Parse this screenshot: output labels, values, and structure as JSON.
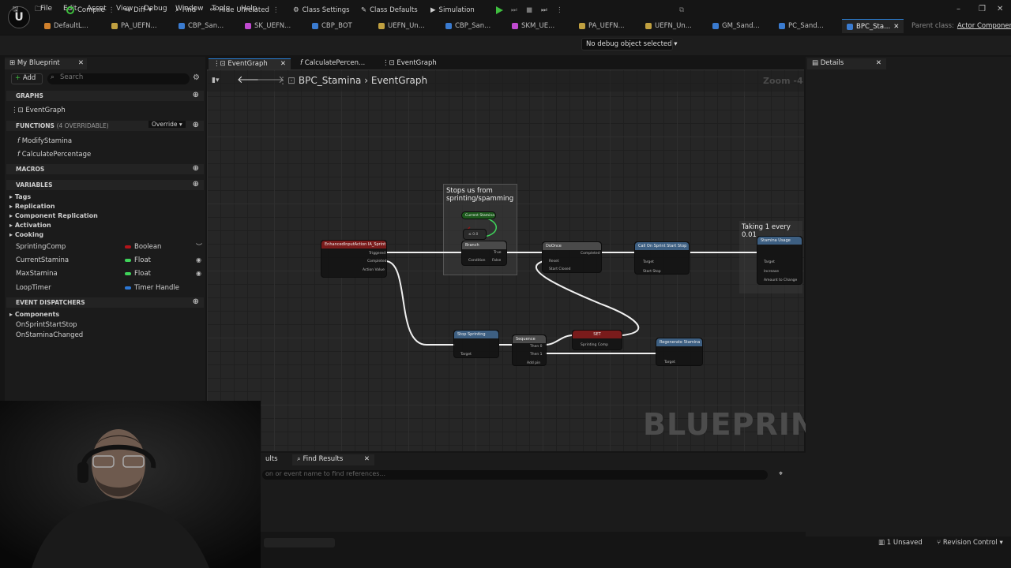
{
  "menu": [
    "File",
    "Edit",
    "Asset",
    "View",
    "Debug",
    "Window",
    "Tools",
    "Help"
  ],
  "tabs": [
    "DefaultL...",
    "PA_UEFN...",
    "CBP_San...",
    "SK_UEFN...",
    "CBP_BOT",
    "UEFN_Un...",
    "CBP_San...",
    "SKM_UE...",
    "PA_UEFN...",
    "UEFN_Un...",
    "GM_Sand...",
    "PC_Sand...",
    "BPC_Sta..."
  ],
  "parent_class": {
    "label": "Parent class:",
    "value": "Actor Component"
  },
  "toolbar": {
    "compile": "Compile",
    "diff": "Diff",
    "find": "Find",
    "hide_unrelated": "Hide Unrelated",
    "class_settings": "Class Settings",
    "class_defaults": "Class Defaults",
    "simulation": "Simulation",
    "debug_object": "No debug object selected"
  },
  "left_panel": {
    "tab": "My Blueprint",
    "add": "Add",
    "search_placeholder": "Search",
    "graphs_header": "GRAPHS",
    "graphs": [
      "EventGraph"
    ],
    "functions_header": "FUNCTIONS",
    "functions_note": "(4 OVERRIDABLE)",
    "override": "Override",
    "functions": [
      "ModifyStamina",
      "CalculatePercentage"
    ],
    "macros_header": "MACROS",
    "variables_header": "VARIABLES",
    "categories": [
      "Tags",
      "Replication",
      "Component Replication",
      "Activation",
      "Cooking"
    ],
    "variables": [
      {
        "name": "SprintingComp",
        "type": "Boolean",
        "color": "#b3141a"
      },
      {
        "name": "CurrentStamina",
        "type": "Float",
        "color": "#3fd35a"
      },
      {
        "name": "MaxStamina",
        "type": "Float",
        "color": "#3fd35a"
      },
      {
        "name": "LoopTimer",
        "type": "Timer Handle",
        "color": "#2c78d6"
      }
    ],
    "dispatchers_header": "EVENT DISPATCHERS",
    "components_label": "Components",
    "dispatchers": [
      "OnSprintStartStop",
      "OnStaminaChanged"
    ]
  },
  "graph_tabs": [
    "EventGraph",
    "CalculatePercen...",
    "EventGraph"
  ],
  "breadcrumb": {
    "blueprint": "BPC_Stamina",
    "graph": "EventGraph"
  },
  "zoom": "Zoom -4",
  "watermark": "BLUEPRINT",
  "comments": [
    "Stops us from sprinting/spamming",
    "Taking 1 every 0.01"
  ],
  "nodes": {
    "enhanced_input": "EnhancedInputAction IA_Sprint",
    "branch": "Branch",
    "do_once": "DoOnce",
    "call_sprint": "Call On Sprint Start Stop",
    "stamina_usage": "Stamina Usage",
    "stop_sprinting": "Stop Sprinting",
    "sequence": "Sequence",
    "set": "SET",
    "regenerate": "Regenerate Stamina",
    "sprinting_comp": "Sprinting Comp",
    "current_stamina": "Current Stamina",
    "pins": {
      "triggered": "Triggered",
      "completed": "Completed",
      "action_value": "Action Value",
      "condition": "Condition",
      "true": "True",
      "false": "False",
      "reset": "Reset",
      "start_closed": "Start Closed",
      "target": "Target",
      "self": "self",
      "start_stop": "Start Stop",
      "increase": "Increase",
      "amount": "Amount to Change",
      "then0": "Then 0",
      "then1": "Then 1",
      "add_pin": "Add pin"
    }
  },
  "details_tab": "Details",
  "find": {
    "tab_results": "ults",
    "tab": "Find Results",
    "placeholder": "on or event name to find references..."
  },
  "status": {
    "unsaved": "1 Unsaved",
    "revision": "Revision Control"
  }
}
